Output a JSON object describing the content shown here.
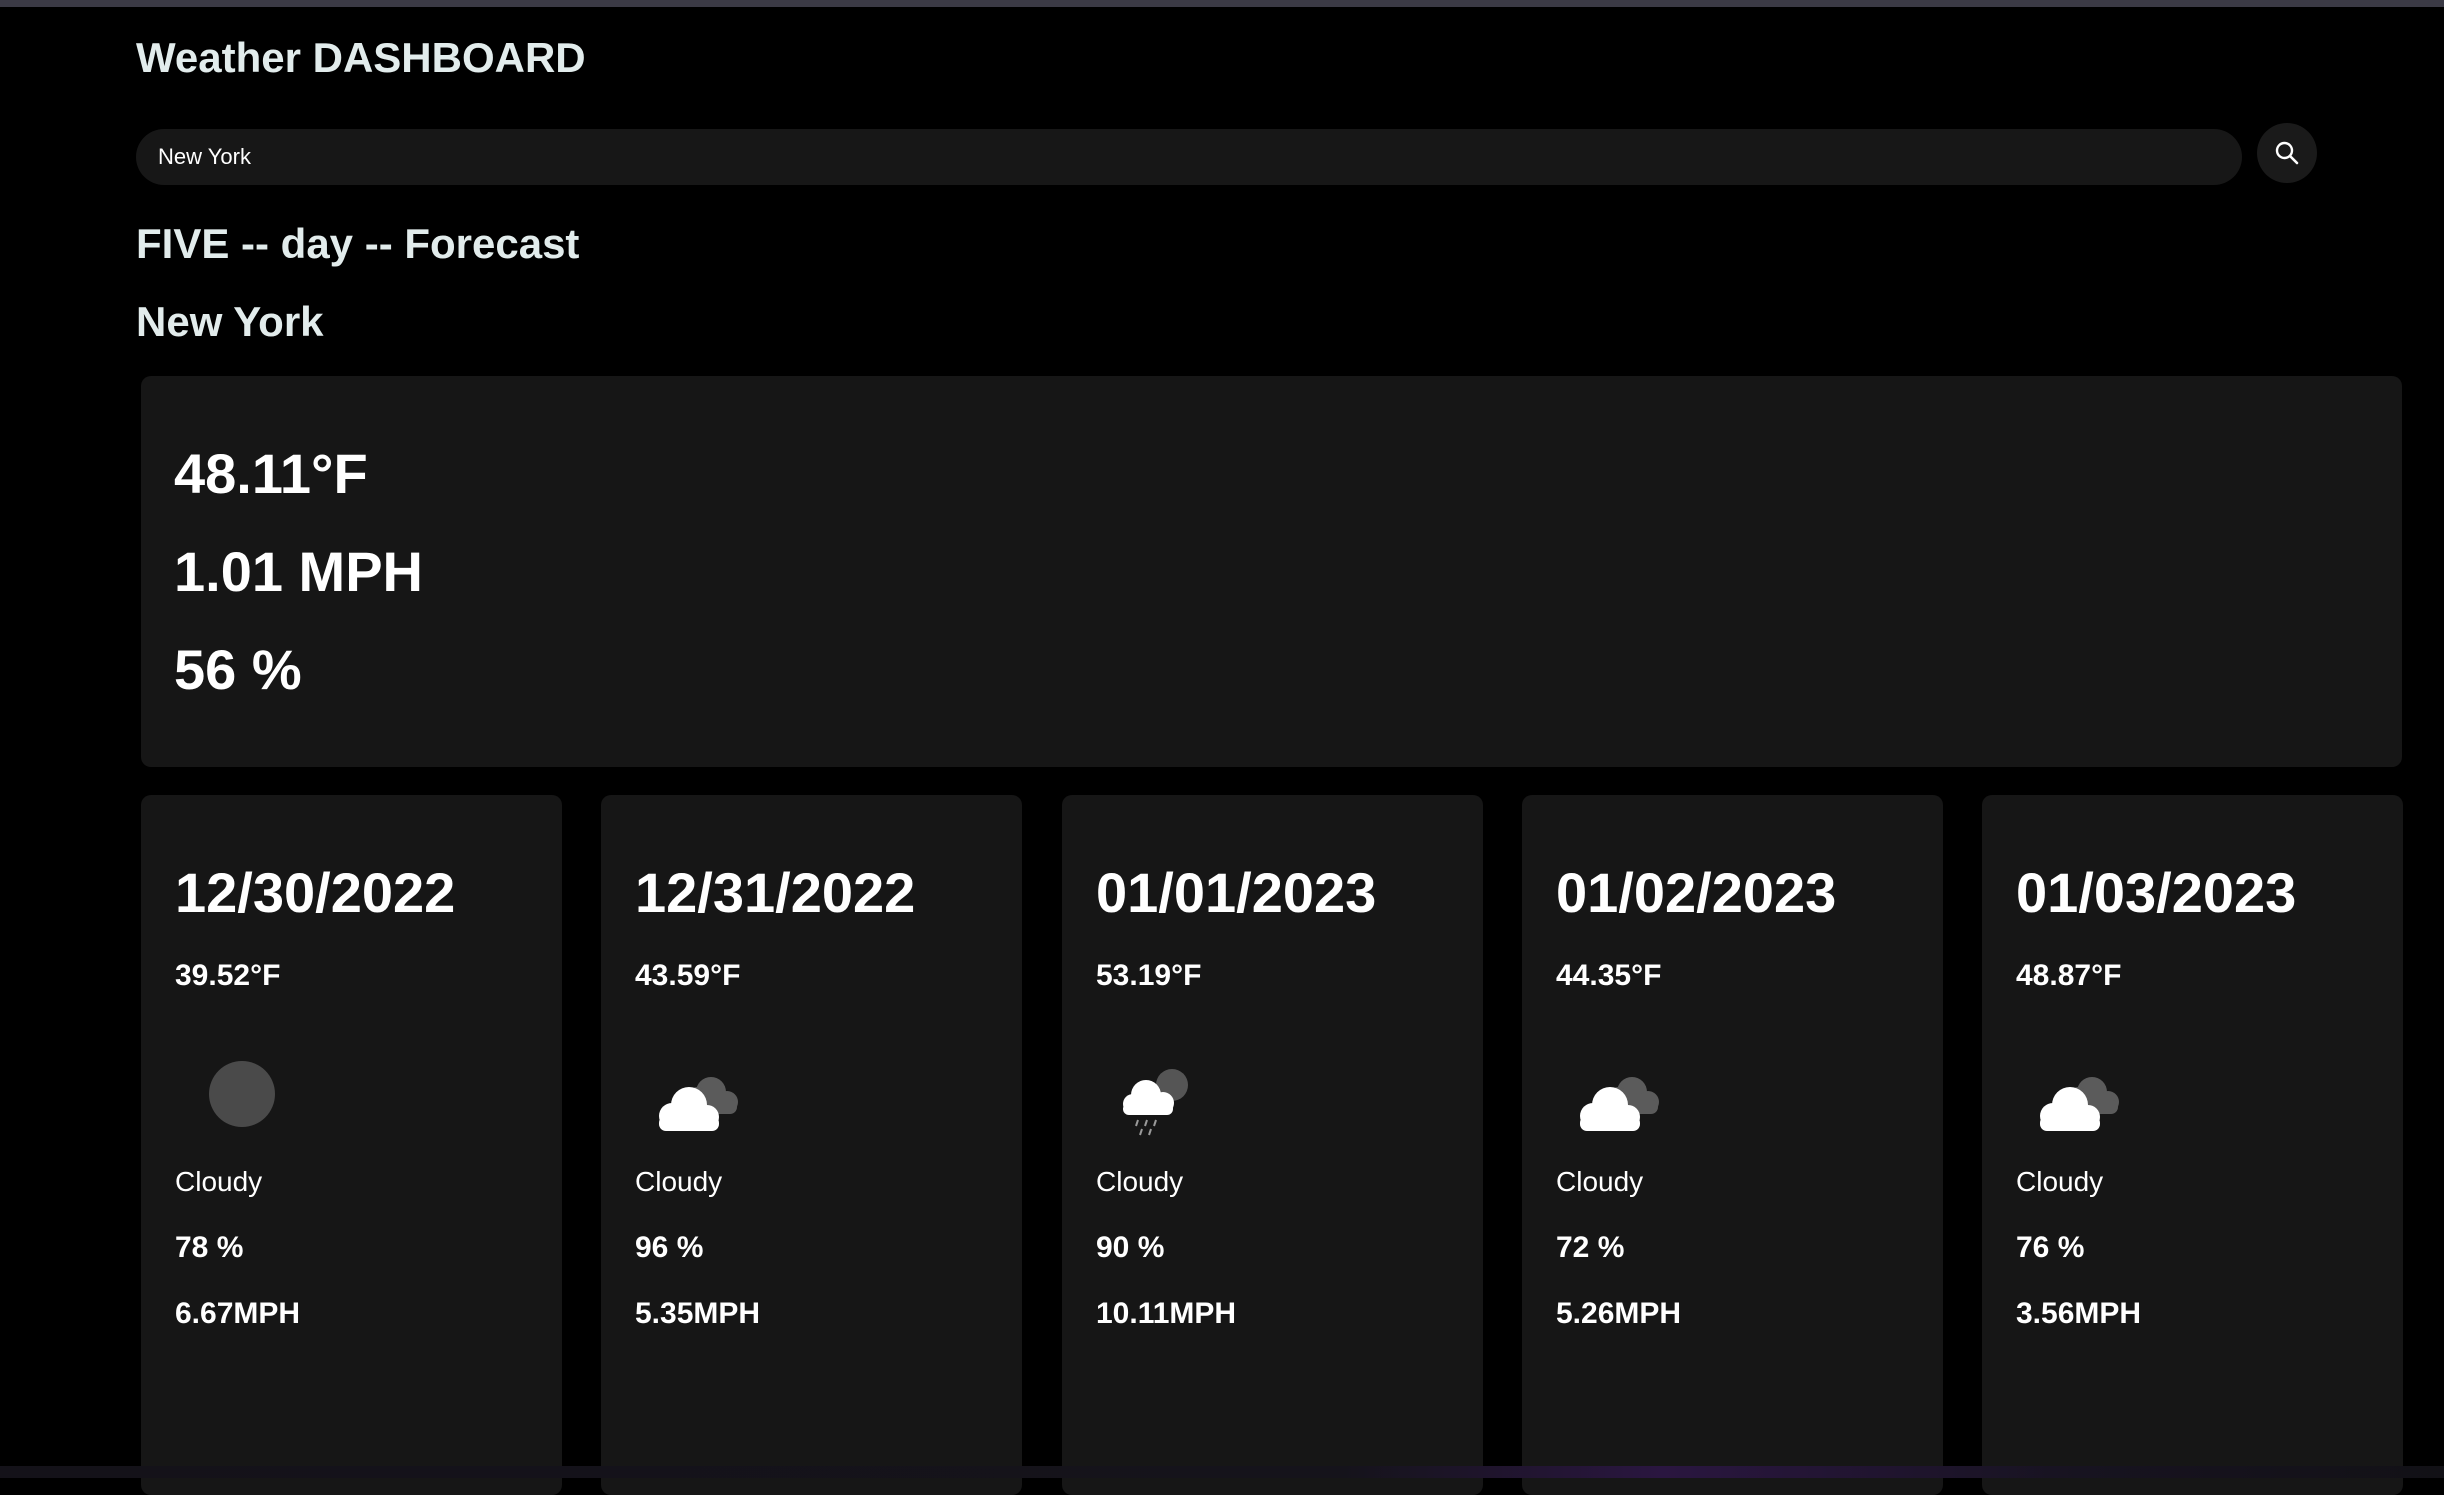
{
  "header": {
    "title": "Weather DASHBOARD"
  },
  "search": {
    "value": "New York",
    "button_icon": "search-icon"
  },
  "forecast_heading": "FIVE -- day -- Forecast",
  "city": "New York",
  "current": {
    "temperature": "48.11°F",
    "wind": "1.01 MPH",
    "humidity": "56 %"
  },
  "forecast": [
    {
      "date": "12/30/2022",
      "temp": "39.52°F",
      "icon": "moon-icon",
      "desc": "Cloudy",
      "humidity": "78 %",
      "wind": "6.67MPH"
    },
    {
      "date": "12/31/2022",
      "temp": "43.59°F",
      "icon": "cloudy-icon",
      "desc": "Cloudy",
      "humidity": "96 %",
      "wind": "5.35MPH"
    },
    {
      "date": "01/01/2023",
      "temp": "53.19°F",
      "icon": "rain-icon",
      "desc": "Cloudy",
      "humidity": "90 %",
      "wind": "10.11MPH"
    },
    {
      "date": "01/02/2023",
      "temp": "44.35°F",
      "icon": "cloudy-icon",
      "desc": "Cloudy",
      "humidity": "72 %",
      "wind": "5.26MPH"
    },
    {
      "date": "01/03/2023",
      "temp": "48.87°F",
      "icon": "cloudy-icon",
      "desc": "Cloudy",
      "humidity": "76 %",
      "wind": "3.56MPH"
    }
  ],
  "colors": {
    "background": "#000000",
    "panel": "#161616",
    "heading": "#e2ecec",
    "text": "#ffffff"
  }
}
